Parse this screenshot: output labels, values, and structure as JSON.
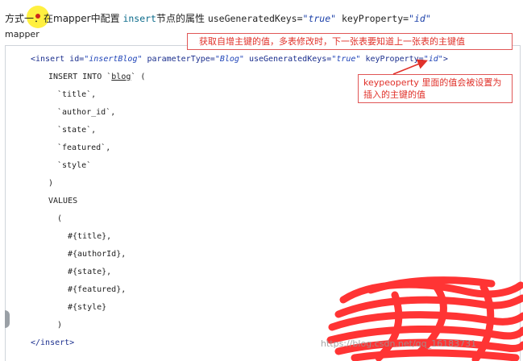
{
  "header": {
    "prefix": "方式一：在",
    "mid": "mapper中配置 ",
    "insert_kw": "insert",
    "suffix": "节点的属性 ",
    "attr1": "useGeneratedKeys=",
    "attr1_val": "\"true\"",
    "attr2": " keyProperty=",
    "attr2_val": "\"id\""
  },
  "sub_label": "mapper",
  "notes": {
    "note1": "获取自增主键的值，多表修改时，下一张表要知道上一张表的主键值",
    "note2_line1": "keypeoperty 里面的值会被设置为",
    "note2_line2": "插入的主键的值"
  },
  "code": {
    "open_tag": "<insert",
    "id_attr": " id=",
    "id_val": "\"insertBlog\"",
    "ptype_attr": " parameterType=",
    "ptype_val": "\"Blog\"",
    "ugk_attr": " useGeneratedKeys=",
    "ugk_val": "\"true\"",
    "kp_attr": " keyProperty=",
    "kp_val": "\"id\"",
    "open_tag_end": ">",
    "insert_into_prefix": "INSERT INTO `",
    "table_name": "blog",
    "insert_into_suffix": "` (",
    "col_title": "`title`,",
    "col_author": "`author_id`,",
    "col_state": "`state`,",
    "col_featured": "`featured`,",
    "col_style": "`style`",
    "close_paren_1": ")",
    "values_kw": "VALUES",
    "open_paren": "(",
    "p_title": "#{title},",
    "p_author": "#{authorId},",
    "p_state": "#{state},",
    "p_featured": "#{featured},",
    "p_style": "#{style}",
    "close_paren_2": ")",
    "close_tag": "</insert>"
  },
  "watermark": "https://blog.csdn.net/qq_16183731",
  "colors": {
    "note_border": "#e05656",
    "note_text": "#e0312a",
    "scribble": "#ff2a2a",
    "highlight": "#ffeb00"
  }
}
